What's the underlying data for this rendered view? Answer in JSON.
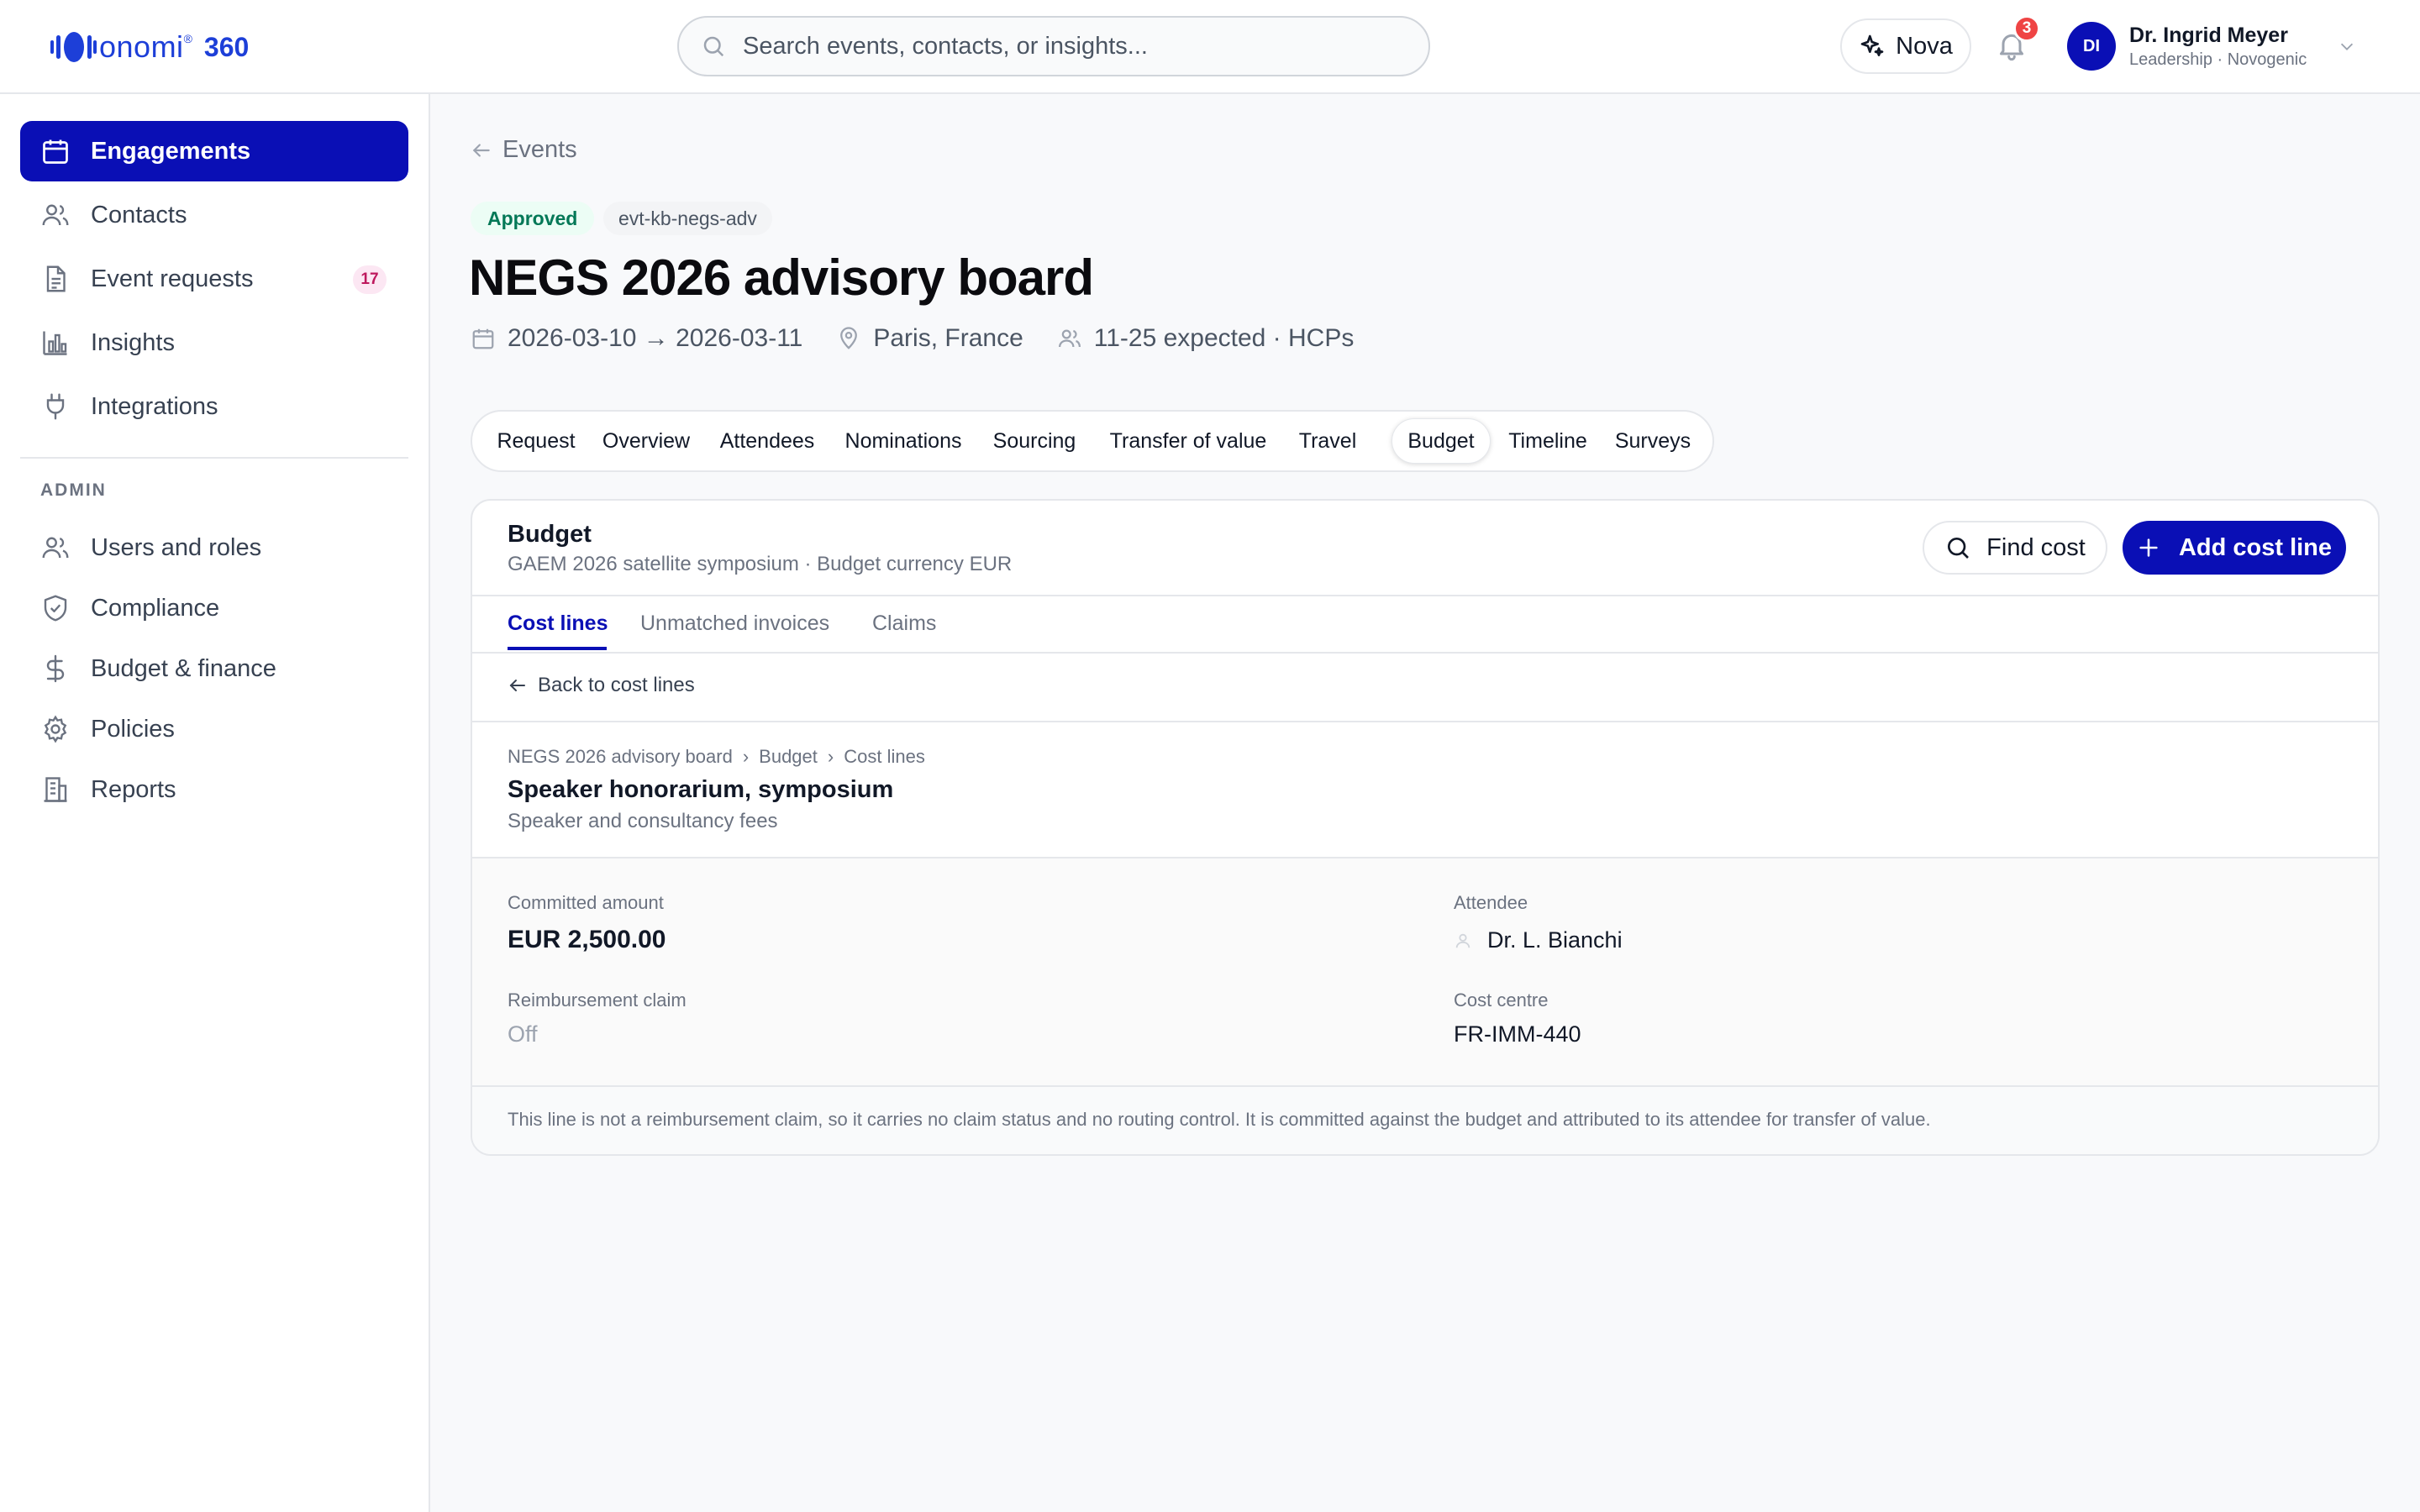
{
  "header": {
    "logo_word": "onomi",
    "logo_reg": "®",
    "logo_suffix": "360",
    "search_placeholder": "Search events, contacts, or insights...",
    "nova_label": "Nova",
    "notification_count": "3",
    "user": {
      "initials": "DI",
      "name": "Dr. Ingrid Meyer",
      "role": "Leadership · Novogenic"
    }
  },
  "sidebar": {
    "items": [
      {
        "label": "Engagements",
        "icon": "calendar-icon",
        "active": true
      },
      {
        "label": "Contacts",
        "icon": "users-icon"
      },
      {
        "label": "Event requests",
        "icon": "document-icon",
        "badge": "17"
      },
      {
        "label": "Insights",
        "icon": "bar-chart-icon"
      },
      {
        "label": "Integrations",
        "icon": "plug-icon"
      }
    ],
    "admin_label": "ADMIN",
    "admin_items": [
      {
        "label": "Users and roles",
        "icon": "users-icon"
      },
      {
        "label": "Compliance",
        "icon": "shield-check-icon"
      },
      {
        "label": "Budget & finance",
        "icon": "dollar-icon"
      },
      {
        "label": "Policies",
        "icon": "gear-icon"
      },
      {
        "label": "Reports",
        "icon": "building-icon"
      }
    ]
  },
  "event": {
    "back_label": "Events",
    "status": "Approved",
    "code": "evt-kb-negs-adv",
    "title": "NEGS 2026 advisory board",
    "dates": "2026-03-10 → 2026-03-11",
    "location": "Paris, France",
    "attendance": "11-25 expected · HCPs",
    "tabs": [
      "Request",
      "Overview",
      "Attendees",
      "Nominations",
      "Sourcing",
      "Transfer of value",
      "Travel",
      "Budget",
      "Timeline",
      "Surveys"
    ],
    "active_tab": "Budget"
  },
  "budget": {
    "title": "Budget",
    "subtitle": "GAEM 2026 satellite symposium · Budget currency EUR",
    "find_label": "Find cost",
    "add_label": "Add cost line",
    "subtabs": [
      "Cost lines",
      "Unmatched invoices",
      "Claims"
    ],
    "active_subtab": "Cost lines",
    "back_label": "Back to cost lines",
    "breadcrumb": [
      "NEGS 2026 advisory board",
      "Budget",
      "Cost lines"
    ],
    "breadcrumb_sep": "›",
    "line": {
      "title": "Speaker honorarium, symposium",
      "category": "Speaker and consultancy fees",
      "committed_label": "Committed amount",
      "committed_value": "EUR 2,500.00",
      "attendee_label": "Attendee",
      "attendee_value": "Dr. L. Bianchi",
      "claim_label": "Reimbursement claim",
      "claim_value": "Off",
      "cost_centre_label": "Cost centre",
      "cost_centre_value": "FR-IMM-440"
    },
    "note": "This line is not a reimbursement claim, so it carries no claim status and no routing control. It is committed against the budget and attributed to its attendee for transfer of value."
  },
  "colors": {
    "brand": "#0a0fb5",
    "logo": "#1d3fd8",
    "approved_bg": "#ecfdf5",
    "approved_text": "#047857",
    "notification": "#ef4444"
  }
}
